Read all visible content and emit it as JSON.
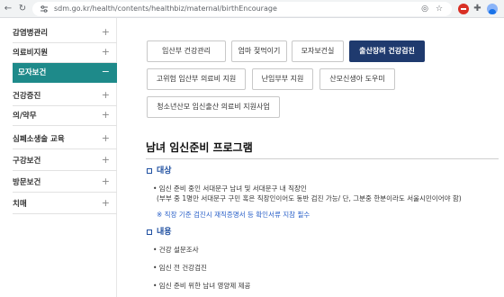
{
  "browser": {
    "url": "sdm.go.kr/health/contents/healthbiz/maternal/birthEncourage",
    "icons": [
      "arrow-back-icon",
      "reload-icon",
      "site-info-icon",
      "eye-off-icon",
      "star-icon",
      "extension-icon",
      "puzzle-icon",
      "profile-avatar"
    ]
  },
  "sidebar": {
    "items": [
      {
        "label": "감염병관리",
        "sign": "+"
      },
      {
        "label": "의료비지원",
        "sign": "+"
      },
      {
        "label": "모자보건",
        "sign": "−",
        "active": true
      },
      {
        "label": "건강증진",
        "sign": "+"
      },
      {
        "label": "의/약무",
        "sign": "+"
      },
      {
        "label": "심폐소생술 교육",
        "sign": "+"
      },
      {
        "label": "구강보건",
        "sign": "+"
      },
      {
        "label": "방문보건",
        "sign": "+"
      },
      {
        "label": "치매",
        "sign": "+"
      }
    ]
  },
  "tabs": {
    "row1": [
      "임산부 건강관리",
      "엄마 젖먹이기",
      "모자보건실",
      "출산장려 건강검진"
    ],
    "row2": [
      "고위험 임산부 의료비 지원",
      "난임부부 지원",
      "산모신생아 도우미"
    ],
    "row3": [
      "청소년산모 임신출산 의료비 지원사업"
    ],
    "active": "출산장려 건강검진"
  },
  "content": {
    "title": "남녀 임신준비 프로그램",
    "target": {
      "heading": "대상",
      "line1": "• 임신 준비 중인 서대문구 남녀 및 서대문구 내 직장인",
      "line2": "(부부 중 1명만 서대문구 구민 혹은 직장인이어도 동반 검진 가능/ 단, 그분중 한분이라도 서울시민이어야 함)",
      "note": "※ 직장 기준 검진시 재직증명서 등 확인서류 지참 필수"
    },
    "contents": {
      "heading": "내용",
      "items": [
        "• 건강 설문조사",
        "• 임신 전 건강검진",
        "• 임신 준비 위한 남녀 영양제 제공"
      ]
    }
  },
  "colors": {
    "sidebar_active": "#1e8a8a",
    "tab_active": "#1f3a6e",
    "section_blue": "#1f4fa0",
    "note_blue": "#2a60c8"
  }
}
